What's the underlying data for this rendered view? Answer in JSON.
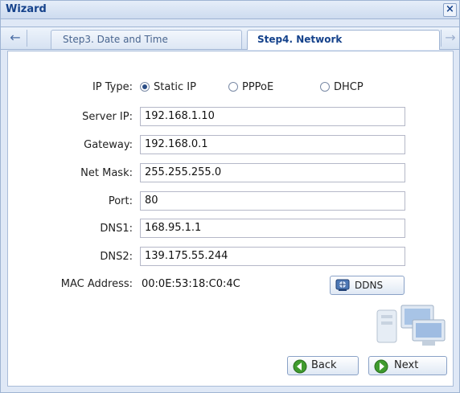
{
  "window": {
    "title": "Wizard"
  },
  "tabs": [
    {
      "label": "Step3. Date and Time",
      "active": false
    },
    {
      "label": "Step4. Network",
      "active": true
    }
  ],
  "form": {
    "ip_type": {
      "label": "IP Type:",
      "options": [
        "Static IP",
        "PPPoE",
        "DHCP"
      ],
      "selected": "Static IP"
    },
    "server_ip": {
      "label": "Server IP:",
      "value": "192.168.1.10"
    },
    "gateway": {
      "label": "Gateway:",
      "value": "192.168.0.1"
    },
    "net_mask": {
      "label": "Net Mask:",
      "value": "255.255.255.0"
    },
    "port": {
      "label": "Port:",
      "value": "80"
    },
    "dns1": {
      "label": "DNS1:",
      "value": "168.95.1.1"
    },
    "dns2": {
      "label": "DNS2:",
      "value": "139.175.55.244"
    },
    "mac": {
      "label": "MAC Address:",
      "value": "00:0E:53:18:C0:4C"
    }
  },
  "buttons": {
    "ddns": "DDNS",
    "back": "Back",
    "next": "Next"
  },
  "colors": {
    "title": "#15428b",
    "border": "#9fb4d3",
    "frame_bg": "#dfe8f6",
    "nav_green": "#3f9b2e"
  },
  "icons": [
    "close-icon",
    "arrow-left-icon",
    "arrow-right-icon",
    "ddns-icon",
    "back-arrow-icon",
    "next-arrow-icon",
    "network-computers-icon"
  ]
}
